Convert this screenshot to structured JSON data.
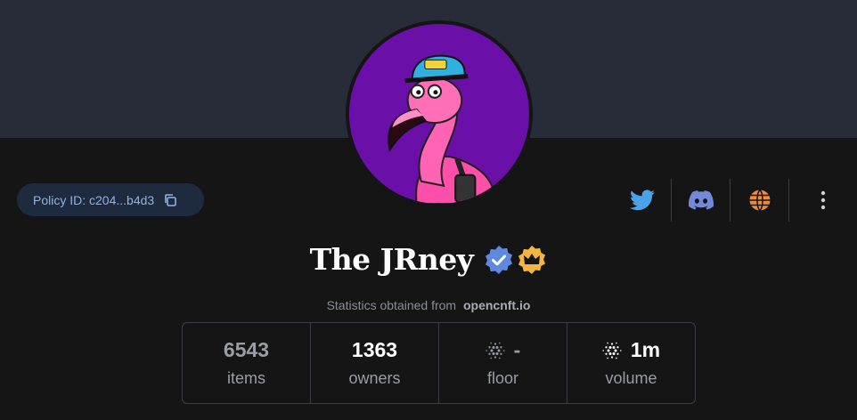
{
  "collection": {
    "name": "The JRney",
    "policy_label": "Policy ID: c204...b4d3"
  },
  "stats_source": {
    "prefix": "Statistics obtained from",
    "source": "opencnft.io"
  },
  "stats": [
    {
      "value": "6543",
      "label": "items",
      "ada_icon": false
    },
    {
      "value": "1363",
      "label": "owners",
      "ada_icon": false
    },
    {
      "value": "-",
      "label": "floor",
      "ada_icon": true
    },
    {
      "value": "1m",
      "label": "volume",
      "ada_icon": true
    }
  ],
  "socials": [
    "twitter-icon",
    "discord-icon",
    "website-globe-icon",
    "more-vertical-icon"
  ],
  "colors": {
    "banner": "#272c38",
    "page_bg": "#151516",
    "avatar_bg": "#6a0fa8",
    "twitter": "#4aa3e8",
    "discord": "#7289da",
    "globe": "#f08a3c",
    "verified_badge": "#5d8ae0",
    "crown_badge": "#f5b53f",
    "policy_text": "#8fb3e8"
  }
}
